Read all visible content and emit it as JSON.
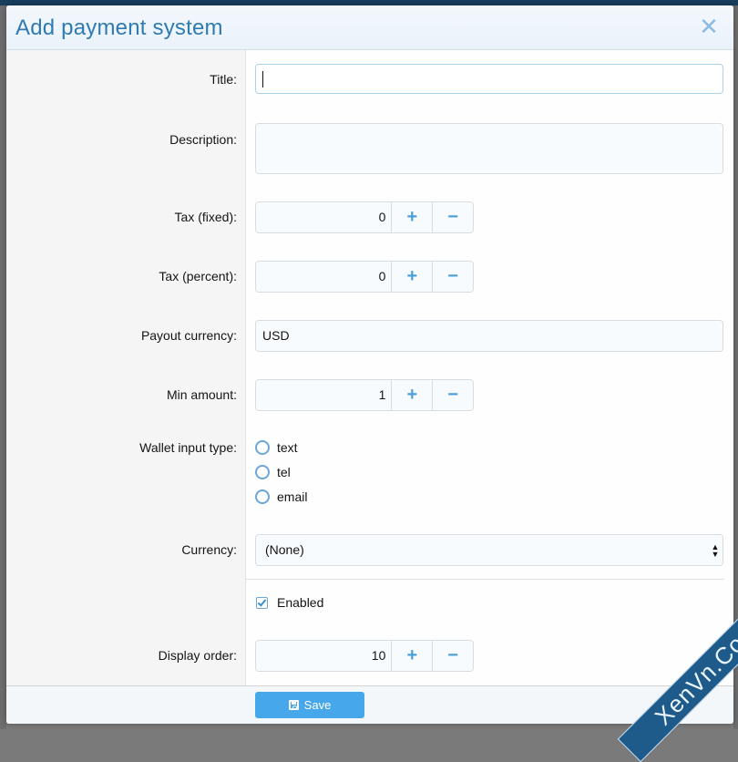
{
  "dialog": {
    "title": "Add payment system",
    "close_icon": "close-icon"
  },
  "form": {
    "title": {
      "label": "Title:",
      "value": ""
    },
    "description": {
      "label": "Description:",
      "value": ""
    },
    "tax_fixed": {
      "label": "Tax (fixed):",
      "value": "0",
      "plus": "+",
      "minus": "−"
    },
    "tax_percent": {
      "label": "Tax (percent):",
      "value": "0",
      "plus": "+",
      "minus": "−"
    },
    "payout_currency": {
      "label": "Payout currency:",
      "value": "USD"
    },
    "min_amount": {
      "label": "Min amount:",
      "value": "1",
      "plus": "+",
      "minus": "−"
    },
    "wallet_input_type": {
      "label": "Wallet input type:",
      "options": [
        "text",
        "tel",
        "email"
      ],
      "selected": null
    },
    "currency": {
      "label": "Currency:",
      "selected": "(None)"
    },
    "enabled": {
      "label": "Enabled",
      "checked": true
    },
    "display_order": {
      "label": "Display order:",
      "value": "10",
      "plus": "+",
      "minus": "−"
    }
  },
  "footer": {
    "save_label": "Save",
    "save_icon": "floppy-disk-icon"
  },
  "watermark": {
    "text": "XenVn.Com"
  },
  "colors": {
    "title": "#2f7bb1",
    "accent": "#47a7eb",
    "stepper_buttons": "#4a9fdb",
    "header_bar": "#183e5e"
  }
}
